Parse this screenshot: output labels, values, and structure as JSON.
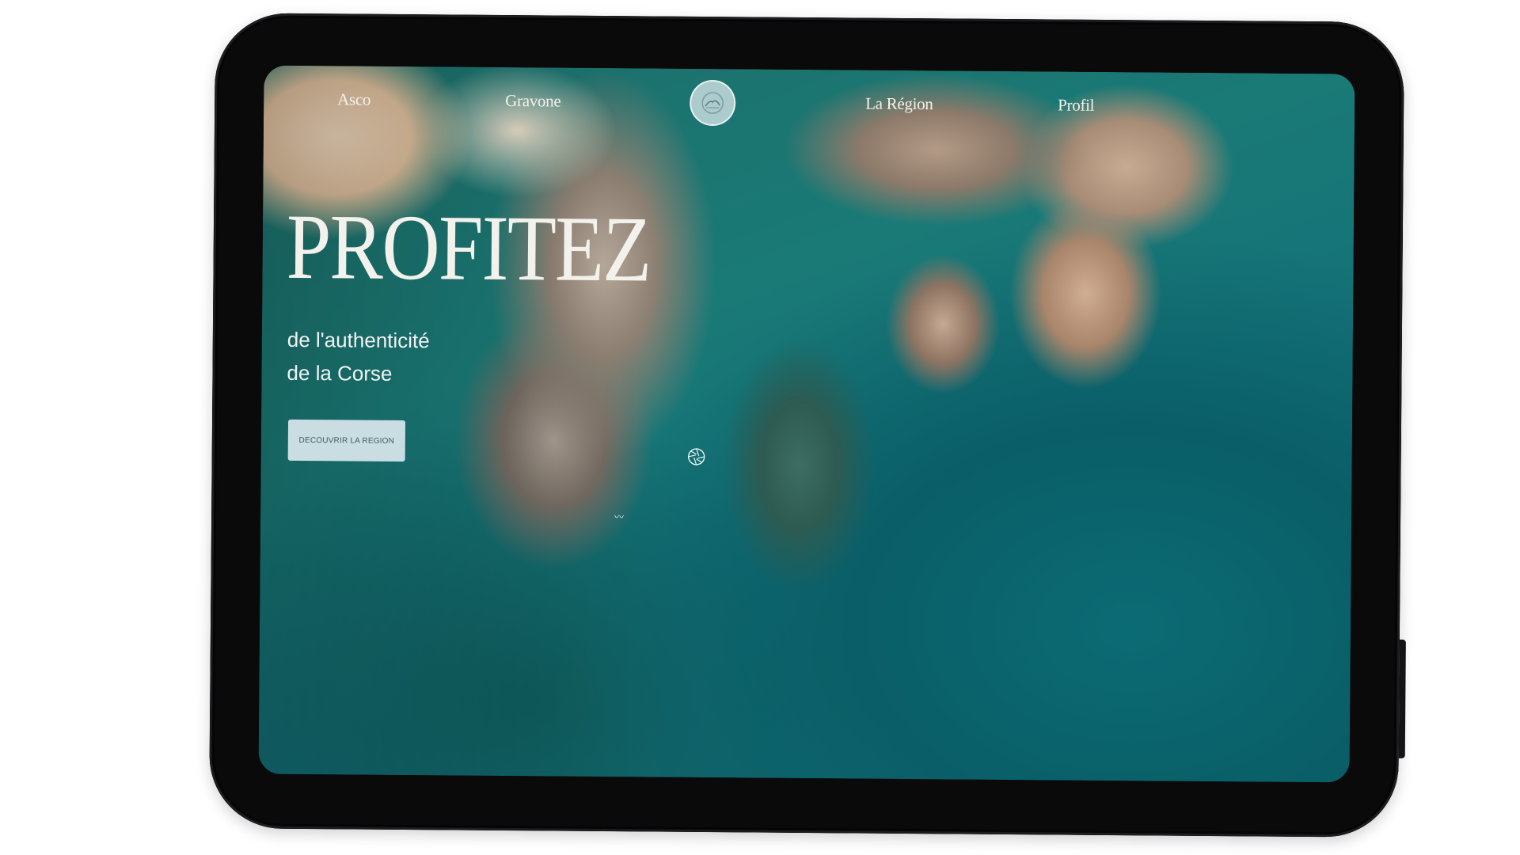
{
  "nav": {
    "items": [
      {
        "label": "Asco"
      },
      {
        "label": "Gravone"
      },
      {
        "label": "La Région"
      },
      {
        "label": "Profil"
      }
    ],
    "logo_icon": "circular-logo"
  },
  "hero": {
    "title": "PROFITEZ",
    "subtitle_line1": "de l'authenticité",
    "subtitle_line2": "de la Corse",
    "cta_label": "DECOUVRIR LA REGION"
  },
  "icons": {
    "center": "aperture-icon"
  },
  "colors": {
    "sea": "#0b6b74",
    "cta_bg": "#c9dde3",
    "text": "#f3f1ec"
  }
}
